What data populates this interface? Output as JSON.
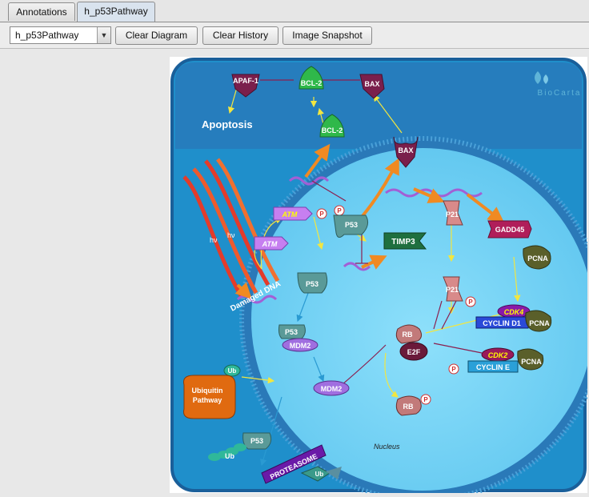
{
  "tabs": [
    {
      "label": "Annotations",
      "active": false
    },
    {
      "label": "h_p53Pathway",
      "active": true
    }
  ],
  "toolbar": {
    "pathway_select": "h_p53Pathway",
    "clear_diagram": "Clear Diagram",
    "clear_history": "Clear History",
    "image_snapshot": "Image Snapshot"
  },
  "diagram": {
    "brand": "BioCarta",
    "nucleus_label": "Nucleus",
    "labels": {
      "apaf1": "APAF-1",
      "bcl2_top": "BCL-2",
      "bax_top": "BAX",
      "apoptosis": "Apoptosis",
      "bcl2_mid": "BCL-2",
      "bax_mid": "BAX",
      "atm1": "ATM",
      "atm2": "ATM",
      "p_atm": "P",
      "p_p53": "P",
      "p53_main": "P53",
      "timp3": "TIMP3",
      "p21_top": "P21",
      "gadd45": "GADD45",
      "pcna1": "PCNA",
      "damaged_dna": "Damaged DNA",
      "hv1": "hν",
      "hv2": "hν",
      "p53_mid": "P53",
      "p21_mid": "P21",
      "p_p21": "P",
      "cdk4": "CDK4",
      "cyclin_d1": "CYCLIN D1",
      "pcna2": "PCNA",
      "p53_mdm2": "P53",
      "mdm2_a": "MDM2",
      "rb": "RB",
      "e2f": "E2F",
      "cdk2": "CDK2",
      "pcna3": "PCNA",
      "cyclin_e": "CYCLIN E",
      "p_cdk2": "P",
      "ub1": "Ub",
      "ubiquitin_pathway_1": "Ubiquitin",
      "ubiquitin_pathway_2": "Pathway",
      "mdm2_b": "MDM2",
      "rb_p": "RB",
      "p_rb": "P",
      "p53_low": "P53",
      "ub2": "Ub",
      "proteasome": "PROTEASOME",
      "ub3": "Ub"
    }
  },
  "colors": {
    "cell_outer": "#1f8fcb",
    "cell_inner_top": "#2b6fb3",
    "nucleus": "#6fd0f5",
    "nucleus_border": "#2a79b8",
    "arrow_yellow": "#f2e640",
    "arrow_orange": "#f08a22",
    "inhibit": "#8b1f4f"
  }
}
